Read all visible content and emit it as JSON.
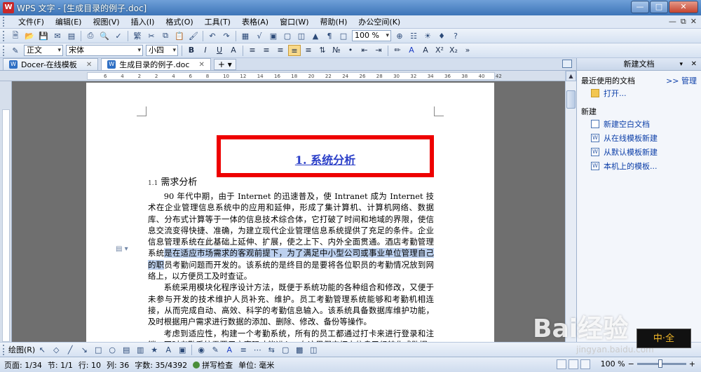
{
  "window": {
    "title": "WPS 文字 - [生成目录的例子.doc]",
    "app_icon": "W"
  },
  "menu": {
    "items": [
      "文件(F)",
      "编辑(E)",
      "视图(V)",
      "插入(I)",
      "格式(O)",
      "工具(T)",
      "表格(A)",
      "窗口(W)",
      "帮助(H)",
      "办公空间(K)"
    ]
  },
  "toolbar1": {
    "zoom": "100 %"
  },
  "toolbar2": {
    "style": "正文",
    "font": "宋体",
    "size": "小四"
  },
  "tabs": [
    {
      "label": "Docer-在线模板"
    },
    {
      "label": "生成目录的例子.doc"
    }
  ],
  "ruler": {
    "ticks": [
      "6",
      "4",
      "2",
      "2",
      "4",
      "6",
      "8",
      "10",
      "12",
      "14",
      "16",
      "18",
      "20",
      "22",
      "24",
      "26",
      "28",
      "30",
      "32",
      "34",
      "36",
      "38",
      "40",
      "42"
    ]
  },
  "document": {
    "heading1": "1. 系统分析",
    "heading2_num": "1.1",
    "heading2": "需求分析",
    "para1_pre": "90 年代中期，由于 Internet 的迅速普及，使 Intranet 成为 Internet 技术在企业管理信息系统中的应用和延伸，形成了集计算机、计算机网络、数据库、分布式计算等于一体的信息技术综合体，它打破了时间和地域的界限，使信息交流变得快捷、准确，为建立现代企业管理信息系统提供了充足的条件。企业信息管理系统在此基础上延伸、扩展，使之上下、内外全面贯通。酒店考勤管理系统",
    "para1_highlight": "是在适应市场需求的客观前提下，为了满足中小型公司或事业单位管理自己的职",
    "para1_post": "员考勤问题而开发的。该系统的是终目的是要将各位职员的考勤情况放到网络上，以方便员工及时查证。",
    "para2": "系统采用模块化程序设计方法，既便于系统功能的各种组合和修改，又便于未参与开发的技术维护人员补充、维护。员工考勤管理系统能够和考勤机相连接，从而完成自动、高效、科学的考勤信息输入。该系统具备数据库维护功能，及时根据用户需求进行数据的添加、删除、修改、备份等操作。",
    "para3": "考虑到适应性，构建一个考勤系统，所有的员工都通过打卡来进行登录和注销，同时考勤系统需要用户密码才能进入。在这里假定打卡信息已经转化成数据"
  },
  "taskpane": {
    "title": "新建文档",
    "recent_label": "最近使用的文档",
    "manage": ">> 管理",
    "open": "打开...",
    "new_label": "新建",
    "links": [
      "新建空白文档",
      "从在线模板新建",
      "从默认模板新建",
      "本机上的模板..."
    ]
  },
  "drawbar": {
    "label": "绘图(R)"
  },
  "status": {
    "page": "页面: 1/34",
    "section": "节: 1/1",
    "row": "行: 10",
    "col": "列: 36",
    "words": "字数: 35/4392",
    "spell": "拼写检查",
    "unit": "单位: 毫米",
    "zoom": "100 %"
  },
  "watermark": {
    "main": "Bai经验",
    "sub": "jingyan.baidu.com",
    "corner": "中·全"
  },
  "colors": {
    "heading_link": "#2b3fc8",
    "highlight_box": "#ee0000",
    "selection": "#bcd0ee"
  }
}
